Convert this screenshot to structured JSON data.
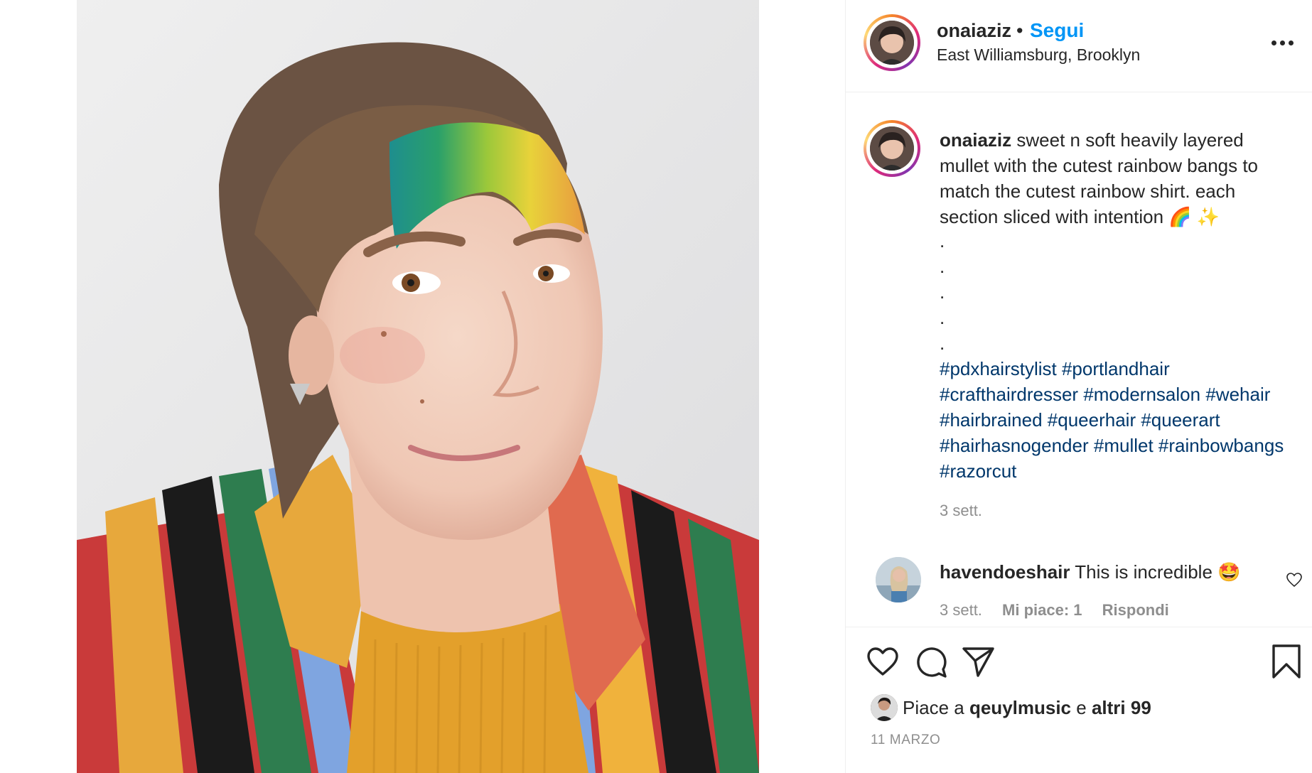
{
  "post": {
    "username": "onaiaziz",
    "separator": "•",
    "follow_label": "Segui",
    "location": "East Williamsburg, Brooklyn"
  },
  "caption": {
    "username": "onaiaziz",
    "text": "sweet n soft heavily layered mullet with the cutest rainbow bangs to match the cutest rainbow shirt. each section sliced with intention 🌈 ✨",
    "dots": [
      ".",
      ".",
      ".",
      ".",
      "."
    ],
    "hashtags": [
      "#pdxhairstylist",
      "#portlandhair",
      "#crafthairdresser",
      "#modernsalon",
      "#wehair",
      "#hairbrained",
      "#queerhair",
      "#queerart",
      "#hairhasnogender",
      "#mullet",
      "#rainbowbangs",
      "#razorcut"
    ],
    "time": "3 sett."
  },
  "comment": {
    "username": "havendoeshair",
    "text": "This is incredible 🤩",
    "time": "3 sett.",
    "likes": "Mi piace: 1",
    "reply": "Rispondi"
  },
  "likes": {
    "prefix": "Piace a",
    "user": "qeuylmusic",
    "conjunction": "e",
    "others": "altri 99"
  },
  "date": "11 MARZO",
  "icons": {
    "like": "heart-icon",
    "comment": "comment-icon",
    "share": "paper-plane-icon",
    "save": "bookmark-icon",
    "more": "more-dots-icon"
  },
  "colors": {
    "follow_blue": "#0095f6",
    "hashtag_blue": "#00376b",
    "meta_gray": "#8e8e8e",
    "text": "#262626"
  }
}
